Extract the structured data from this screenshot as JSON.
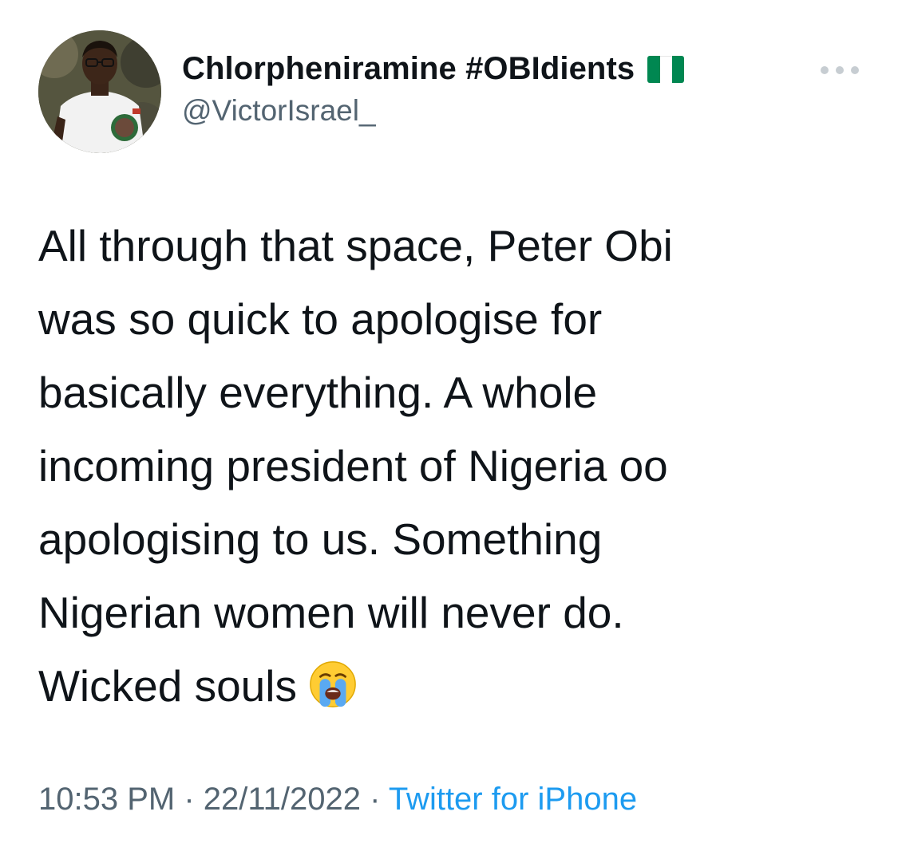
{
  "author": {
    "display_name": "Chlorpheniramine #OBIdients",
    "handle": "@VictorIsrael_",
    "flag_icon": "nigeria-flag-icon",
    "flag_colors": [
      "#008751",
      "#ffffff",
      "#008751"
    ]
  },
  "menu": {
    "icon": "more-options-icon"
  },
  "tweet": {
    "lines": [
      "All through that space, Peter Obi",
      "was so quick to apologise for",
      "basically everything. A whole",
      "incoming president of Nigeria oo",
      "apologising to us. Something",
      "Nigerian women will never do.",
      "Wicked souls"
    ],
    "emoji": "loudly-crying-face-icon"
  },
  "meta": {
    "time": "10:53 PM",
    "separator": " · ",
    "date": "22/11/2022",
    "source": "Twitter for iPhone"
  },
  "colors": {
    "text_primary": "#0f1419",
    "text_secondary": "#536471",
    "link": "#1d9bf0"
  }
}
